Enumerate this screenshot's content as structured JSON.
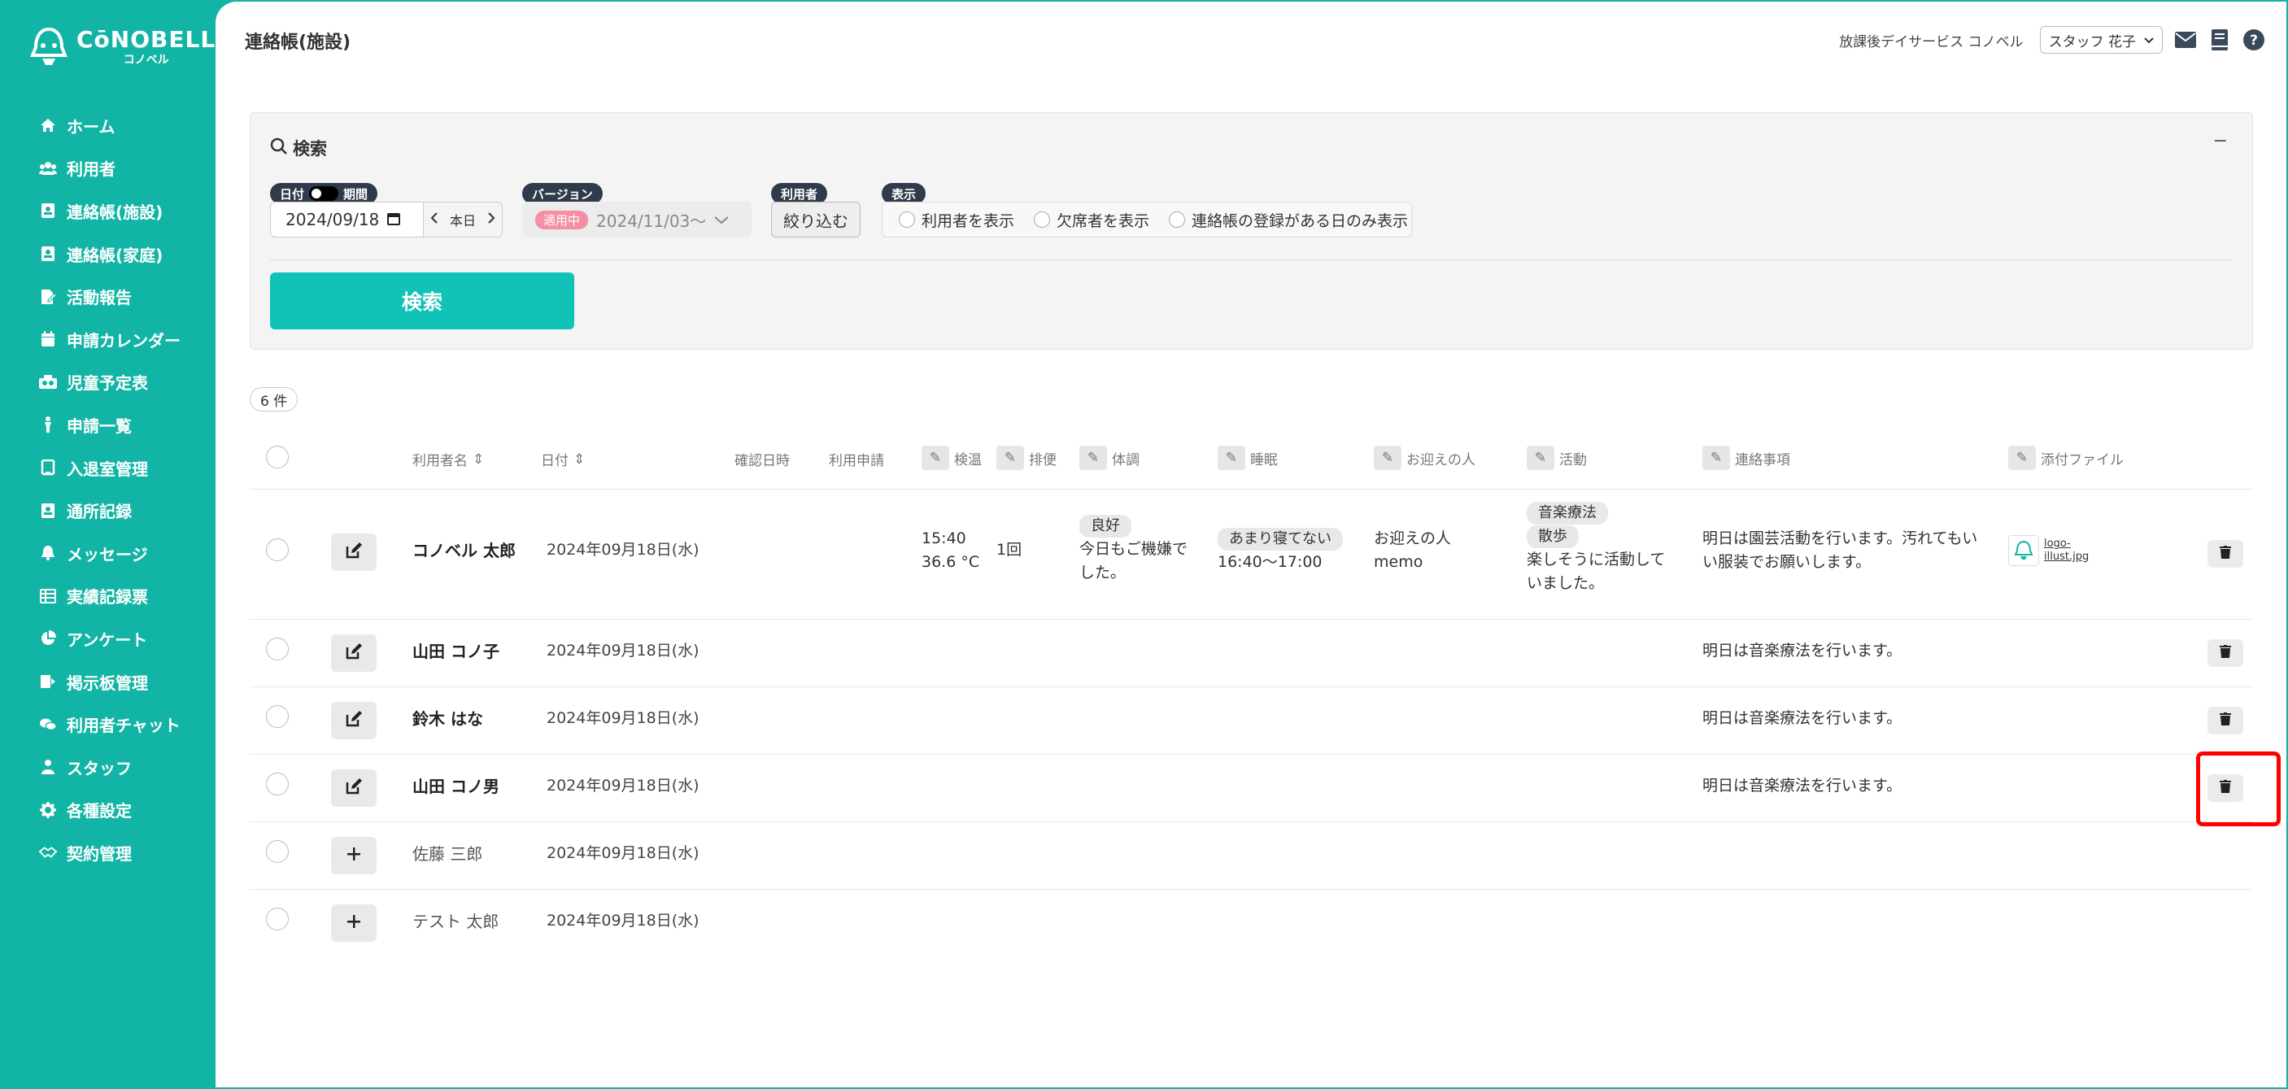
{
  "sidebar": {
    "logo_main": "CōNOBELL",
    "logo_sub": "コノベル",
    "items": [
      {
        "label": "ホーム",
        "icon": "home-icon"
      },
      {
        "label": "利用者",
        "icon": "users-icon"
      },
      {
        "label": "連絡帳(施設)",
        "icon": "contact-book-icon"
      },
      {
        "label": "連絡帳(家庭)",
        "icon": "contact-book-icon"
      },
      {
        "label": "活動報告",
        "icon": "report-icon"
      },
      {
        "label": "申請カレンダー",
        "icon": "calendar-icon"
      },
      {
        "label": "児童予定表",
        "icon": "schedule-icon"
      },
      {
        "label": "申請一覧",
        "icon": "person-icon"
      },
      {
        "label": "入退室管理",
        "icon": "entry-icon"
      },
      {
        "label": "通所記録",
        "icon": "record-icon"
      },
      {
        "label": "メッセージ",
        "icon": "bell-icon"
      },
      {
        "label": "実績記録票",
        "icon": "table-icon"
      },
      {
        "label": "アンケート",
        "icon": "pie-chart-icon"
      },
      {
        "label": "掲示板管理",
        "icon": "board-icon"
      },
      {
        "label": "利用者チャット",
        "icon": "chat-icon"
      },
      {
        "label": "スタッフ",
        "icon": "staff-icon"
      },
      {
        "label": "各種設定",
        "icon": "gear-icon"
      },
      {
        "label": "契約管理",
        "icon": "contract-icon"
      }
    ]
  },
  "header": {
    "title": "連絡帳(施設)",
    "facility": "放課後デイサービス コノベル",
    "staff": "スタッフ 花子"
  },
  "search": {
    "title": "検索",
    "collapse": "−",
    "date_tag_left": "日付",
    "date_tag_right": "期間",
    "date_value": "2024/09/18",
    "today": "本日",
    "version_tag": "バージョン",
    "version_badge": "適用中",
    "version_value": "2024/11/03〜",
    "user_tag": "利用者",
    "filter_button": "絞り込む",
    "display_tag": "表示",
    "display_options": [
      "利用者を表示",
      "欠席者を表示",
      "連絡帳の登録がある日のみ表示"
    ],
    "search_button": "検索"
  },
  "count": "6 件",
  "table": {
    "headers": {
      "name": "利用者名",
      "date": "日付",
      "confirm": "確認日時",
      "request": "利用申請",
      "temp": "検温",
      "bowel": "排便",
      "condition": "体調",
      "sleep": "睡眠",
      "pickup": "お迎えの人",
      "activity": "活動",
      "notes": "連絡事項",
      "attachment": "添付ファイル"
    },
    "rows": [
      {
        "name": "コノベル 太郎",
        "date": "2024年09月18日(水)",
        "temp_time": "15:40",
        "temp_value": "36.6 °C",
        "bowel": "1回",
        "condition_chip": "良好",
        "condition_text": "今日もご機嫌でした。",
        "sleep_chip": "あまり寝てない",
        "sleep_time": "16:40〜17:00",
        "pickup": "お迎えの人",
        "pickup_memo": "memo",
        "activity_chip1": "音楽療法",
        "activity_chip2": "散歩",
        "activity_text": "楽しそうに活動していました。",
        "notes": "明日は園芸活動を行います。汚れてもいい服装でお願いします。",
        "file_name": "logo-illust.jpg"
      },
      {
        "name": "山田 コノ子",
        "date": "2024年09月18日(水)",
        "notes": "明日は音楽療法を行います。"
      },
      {
        "name": "鈴木 はな",
        "date": "2024年09月18日(水)",
        "notes": "明日は音楽療法を行います。"
      },
      {
        "name": "山田 コノ男",
        "date": "2024年09月18日(水)",
        "notes": "明日は音楽療法を行います。"
      },
      {
        "name": "佐藤 三郎",
        "date": "2024年09月18日(水)"
      },
      {
        "name": "テスト 太郎",
        "date": "2024年09月18日(水)"
      }
    ]
  },
  "colors": {
    "sidebar": "#12b5a5",
    "primary_button": "#11c2b6",
    "highlight": "#ff0000",
    "version_badge": "#f48fa4"
  }
}
